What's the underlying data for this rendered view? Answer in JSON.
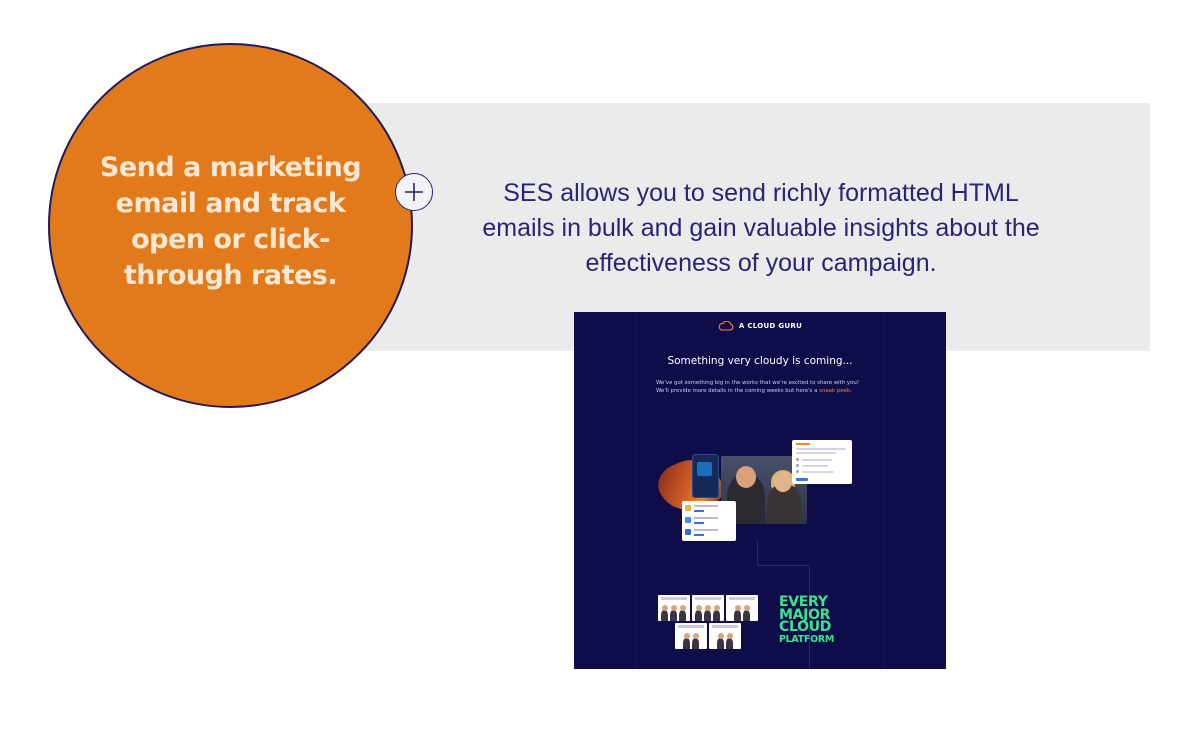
{
  "circle": {
    "title": "Send a marketing email and track open or click-through rates."
  },
  "description": "SES allows you to send richly formatted HTML emails in bulk and gain valuable insights about the effectiveness of your campaign.",
  "email_preview": {
    "brand": "A CLOUD GURU",
    "headline": "Something very cloudy is coming...",
    "body": "We've got something big in the works that we're excited to share with you! We'll provide more details in the coming weeks but here's a",
    "body_highlight": "sneak peek:",
    "tagline": [
      "EVERY",
      "MAJOR",
      "CLOUD",
      "PLATFORM"
    ]
  },
  "colors": {
    "accent_orange": "#e27a1c",
    "navy_text": "#2a2478",
    "email_bg": "#0f0c4a",
    "green": "#3ee28d"
  },
  "icons": {
    "expand": "plus-icon",
    "logo": "cloud-logo-icon"
  }
}
